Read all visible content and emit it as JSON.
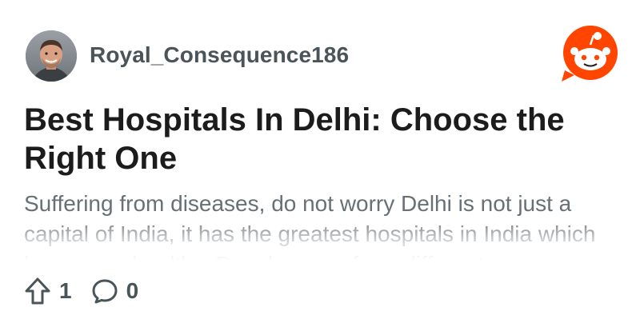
{
  "post": {
    "author": "Royal_Consequence186",
    "title": "Best Hospitals In Delhi: Choose the Right One",
    "body": "Suffering from diseases, do not worry Delhi is not just a capital of India, it has the greatest hospitals in India which keeps you healthy. People come from different"
  },
  "stats": {
    "upvotes": "1",
    "comments": "0"
  },
  "icons": {
    "upvote": "arrow-up-outline-icon",
    "comment": "speech-bubble-icon",
    "brand": "reddit-snoo-logo"
  },
  "colors": {
    "brand": "#ff4500",
    "title": "#1c1c1c",
    "username": "#4a5459",
    "body": "#687076"
  }
}
